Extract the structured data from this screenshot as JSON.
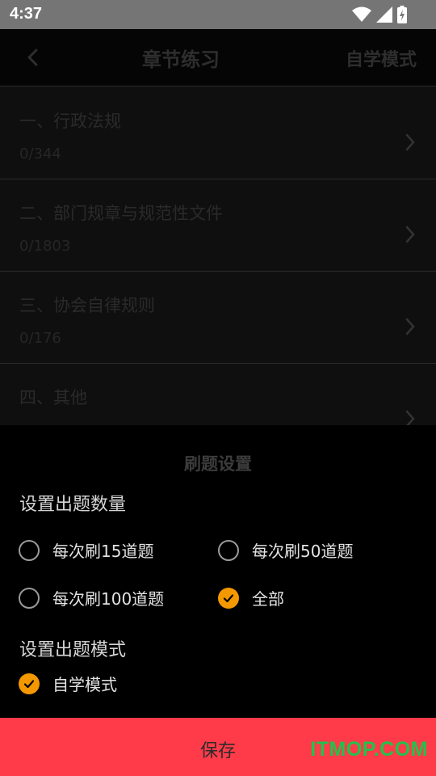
{
  "status_bar": {
    "time": "4:37"
  },
  "toolbar": {
    "title": "章节练习",
    "mode_action": "自学模式"
  },
  "chapters": [
    {
      "name": "一、行政法规",
      "count": "0/344"
    },
    {
      "name": "二、部门规章与规范性文件",
      "count": "0/1803"
    },
    {
      "name": "三、协会自律规则",
      "count": "0/176"
    },
    {
      "name": "四、其他",
      "count": ""
    }
  ],
  "sheet": {
    "title": "刷题设置",
    "quantity_label": "设置出题数量",
    "quantity_options": [
      {
        "label": "每次刷15道题",
        "checked": false
      },
      {
        "label": "每次刷50道题",
        "checked": false
      },
      {
        "label": "每次刷100道题",
        "checked": false
      },
      {
        "label": "全部",
        "checked": true
      }
    ],
    "mode_label": "设置出题模式",
    "mode_options": [
      {
        "label": "自学模式",
        "checked": true
      }
    ],
    "save_label": "保存"
  },
  "watermark": "ITMOP.COM",
  "colors": {
    "accent": "#f39800",
    "save_button": "#ff3b4a",
    "watermark": "#22c24a",
    "status_bar": "#757575"
  }
}
